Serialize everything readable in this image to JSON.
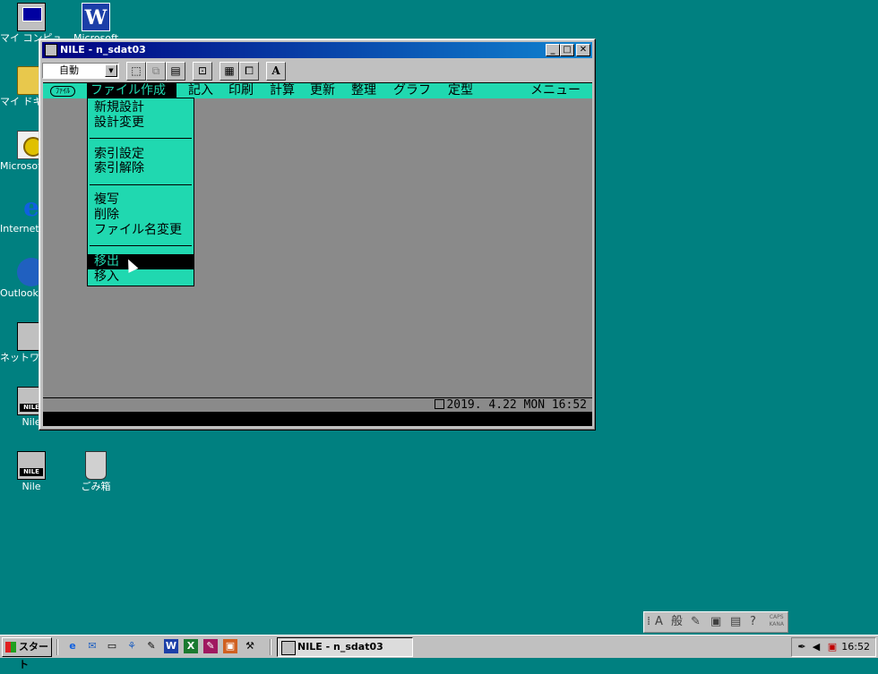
{
  "desktop": {
    "icons": [
      {
        "label": "マイ コンピュータ"
      },
      {
        "label": "Microsoft"
      },
      {
        "label": "マイ ドキュメント"
      },
      {
        "label": "Microsoft Outlook"
      },
      {
        "label": "Internet Explorer"
      },
      {
        "label": "Outlook Express"
      },
      {
        "label": "ネットワーク コンピュータ"
      },
      {
        "label": "Nile"
      },
      {
        "label": "Nile"
      },
      {
        "label": "ごみ箱"
      }
    ]
  },
  "window": {
    "title": "NILE - n_sdat03",
    "buttons": {
      "minimize": "_",
      "maximize": "□",
      "close": "✕"
    },
    "toolbar": {
      "combo_value": "自動",
      "font_button": "A"
    },
    "menubar": {
      "file_chip": "ﾌｧｲﾙ",
      "items": [
        "ファイル作成",
        "記入",
        "印刷",
        "計算",
        "更新",
        "整理",
        "グラフ",
        "定型",
        "メニュー"
      ]
    },
    "dropdown": {
      "groups": [
        [
          "新規設計",
          "設計変更"
        ],
        [
          "索引設定",
          "索引解除"
        ],
        [
          "複写",
          "削除",
          "ファイル名変更"
        ],
        [
          "移出",
          "移入"
        ]
      ],
      "selected": "移出"
    },
    "status": "2019. 4.22 MON 16:52"
  },
  "imebar": {
    "mode": "般",
    "caps": "CAPS",
    "kana": "KANA"
  },
  "taskbar": {
    "start_label": "スタート",
    "task_label": "NILE - n_sdat03",
    "clock": "16:52"
  }
}
